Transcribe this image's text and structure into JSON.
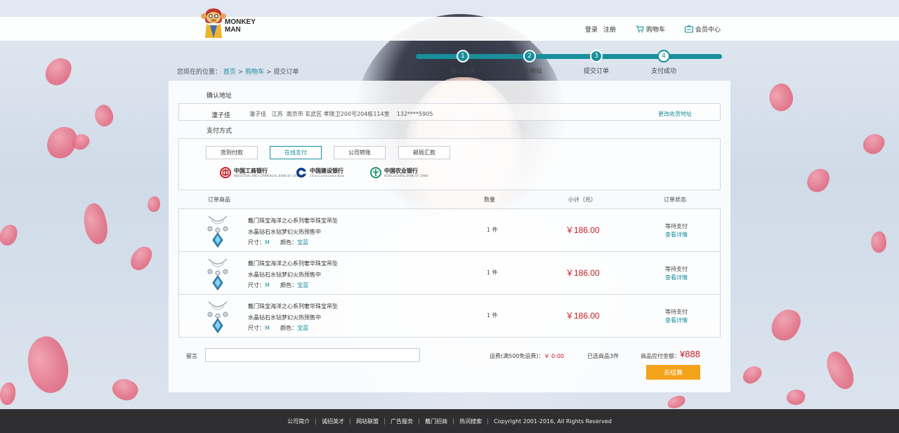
{
  "brand": {
    "logo_line1": "MONKEY",
    "logo_line2": "MAN"
  },
  "header": {
    "login": "登录",
    "register": "注册",
    "cart": "购物车",
    "member_center": "会员中心"
  },
  "breadcrumb": {
    "prefix": "您现在的位置：",
    "home": "首页",
    "sep": ">",
    "cart": "购物车",
    "current": "提交订单"
  },
  "steps": [
    {
      "num": "1",
      "label": "确认订单"
    },
    {
      "num": "2",
      "label": "确认地址"
    },
    {
      "num": "3",
      "label": "提交订单"
    },
    {
      "num": "4",
      "label": "支付成功"
    }
  ],
  "address": {
    "section_title": "确认地址",
    "name": "潼子佳",
    "detail": "潼子佳   江苏  南京市 玄武区 孝陵卫200号204栋114室    132****5905",
    "change_link": "更改收货地址"
  },
  "payment": {
    "section_title": "支付方式",
    "methods": [
      "货到付款",
      "在线支付",
      "公司转账",
      "邮局汇款"
    ],
    "selected": "在线支付",
    "banks": [
      {
        "name": "中国工商银行",
        "en": "INDUSTRIAL AND COMMERCIAL BANK OF CHINA",
        "color": "#c81d25",
        "icon": "icbc-logo-icon"
      },
      {
        "name": "中国建设银行",
        "en": "China Construction Bank",
        "color": "#0f3e8a",
        "icon": "ccb-logo-icon"
      },
      {
        "name": "中国农业银行",
        "en": "AGRICULTURAL BANK OF CHINA",
        "color": "#0e8a62",
        "icon": "abc-logo-icon"
      }
    ]
  },
  "orders": {
    "headers": {
      "product": "订单商品",
      "qty": "数量",
      "subtotal": "小计（元）",
      "status": "订单状态"
    },
    "items": [
      {
        "title": "戴门珠宝海洋之心系列奢华珠宝吊坠",
        "subtitle": "水晶钻石水钻梦幻火热预售中",
        "size_label": "尺寸：",
        "size": "M",
        "color_label": "颜色：",
        "color": "宝蓝",
        "qty": "1 件",
        "price": "￥186.00",
        "status": "等待支付",
        "detail": "查看详情"
      },
      {
        "title": "戴门珠宝海洋之心系列奢华珠宝吊坠",
        "subtitle": "水晶钻石水钻梦幻火热预售中",
        "size_label": "尺寸：",
        "size": "M",
        "color_label": "颜色：",
        "color": "宝蓝",
        "qty": "1 件",
        "price": "￥186.00",
        "status": "等待支付",
        "detail": "查看详情"
      },
      {
        "title": "戴门珠宝海洋之心系列奢华珠宝吊坠",
        "subtitle": "水晶钻石水钻梦幻火热预售中",
        "size_label": "尺寸：",
        "size": "M",
        "color_label": "颜色：",
        "color": "宝蓝",
        "qty": "1 件",
        "price": "￥186.00",
        "status": "等待支付",
        "detail": "查看详情"
      }
    ]
  },
  "summary": {
    "message_label": "留言",
    "message_value": "",
    "shipping_label": "运费(满500免运费)：",
    "shipping_value": "￥ 0:00",
    "count_text": "已选商品3件",
    "total_label": "商品应付金额：",
    "total_value": "¥888",
    "checkout": "去结算"
  },
  "footer": {
    "links": [
      "公司简介",
      "诚招英才",
      "网站联盟",
      "广告服务",
      "戴门招商",
      "热词搜索"
    ],
    "copyright": "Copyright   2001-2016, All Rights Reserved"
  },
  "colors": {
    "accent": "#188f9c",
    "price": "#c81d25",
    "checkout": "#f5a21b",
    "footer": "#2f2f31"
  }
}
